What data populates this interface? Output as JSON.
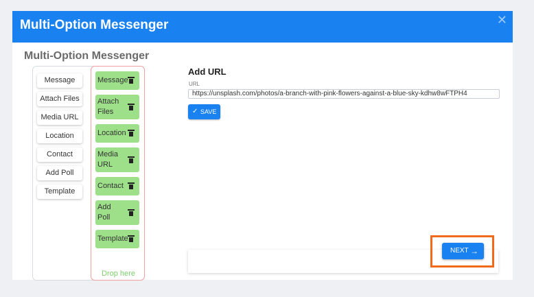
{
  "dialog": {
    "title": "Multi-Option Messenger",
    "subtitle": "Multi-Option Messenger",
    "close_symbol": "✕"
  },
  "options": [
    {
      "label": "Message"
    },
    {
      "label": "Attach Files"
    },
    {
      "label": "Media URL"
    },
    {
      "label": "Location"
    },
    {
      "label": "Contact"
    },
    {
      "label": "Add Poll"
    },
    {
      "label": "Template"
    }
  ],
  "dropped": [
    {
      "line1": "Message",
      "line2": ""
    },
    {
      "line1": "Attach",
      "line2": "Files"
    },
    {
      "line1": "Location",
      "line2": ""
    },
    {
      "line1": "Media",
      "line2": "URL"
    },
    {
      "line1": "Contact",
      "line2": ""
    },
    {
      "line1": "Add",
      "line2": "Poll"
    },
    {
      "line1": "Template",
      "line2": ""
    }
  ],
  "drop_hint": "Drop here",
  "url_form": {
    "heading": "Add URL",
    "field_label": "URL",
    "value": "https://unsplash.com/photos/a-branch-with-pink-flowers-against-a-blue-sky-kdhw8wFTPH4",
    "save_label": "SAVE",
    "save_icon": "check-icon"
  },
  "footer": {
    "next_label": "NEXT",
    "next_icon": "arrow-right-icon"
  },
  "colors": {
    "primary": "#1a82f0",
    "dropped_item": "#9ee08a",
    "highlight": "#f06a1c"
  }
}
